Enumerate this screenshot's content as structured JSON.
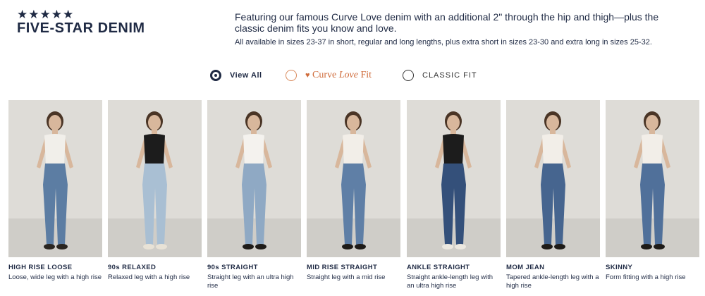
{
  "header": {
    "stars": "★★★★★",
    "title": "FIVE-STAR DENIM",
    "description": "Featuring our famous Curve Love denim with an additional 2\" through the hip and thigh—plus the classic denim fits you know and love.",
    "sizes_note": "All available in sizes 23-37 in short, regular and long lengths, plus extra short in sizes 23-30 and extra long in sizes 25-32."
  },
  "filters": {
    "view_all": "View All",
    "curve_heart": "♥",
    "curve_word1": "Curve",
    "curve_word2": "Love",
    "curve_word3": "Fit",
    "classic": "CLASSIC FIT",
    "selected": "View All"
  },
  "colors": {
    "navy": "#1f2a44",
    "curve_orange": "#cf6b3a",
    "photo_bg": "#dcdbd6"
  },
  "products": [
    {
      "name": "HIGH RISE LOOSE",
      "desc": "Loose, wide leg with a high rise",
      "top": "#f1efea",
      "denim": "#5c7da3",
      "shoe": "#2a2520"
    },
    {
      "name": "90s RELAXED",
      "desc": "Relaxed leg with a high rise",
      "top": "#1c1c1c",
      "denim": "#a9bfd3",
      "shoe": "#e8e2d6"
    },
    {
      "name": "90s STRAIGHT",
      "desc": "Straight leg with an ultra high rise",
      "top": "#f4f2ee",
      "denim": "#8fa9c4",
      "shoe": "#1e1b18"
    },
    {
      "name": "MID RISE STRAIGHT",
      "desc": "Straight leg with a mid rise",
      "top": "#f2eee8",
      "denim": "#5f7fa6",
      "shoe": "#1e1b18"
    },
    {
      "name": "ANKLE STRAIGHT",
      "desc": "Straight ankle-length leg with an ultra high rise",
      "top": "#1c1c1c",
      "denim": "#34507a",
      "shoe": "#ece8e0"
    },
    {
      "name": "MOM JEAN",
      "desc": "Tapered ankle-length leg with a high rise",
      "top": "#f2eee8",
      "denim": "#46658f",
      "shoe": "#1e1b18"
    },
    {
      "name": "SKINNY",
      "desc": "Form fitting with a high rise",
      "top": "#f2eee8",
      "denim": "#50709a",
      "shoe": "#1e1b18"
    }
  ]
}
